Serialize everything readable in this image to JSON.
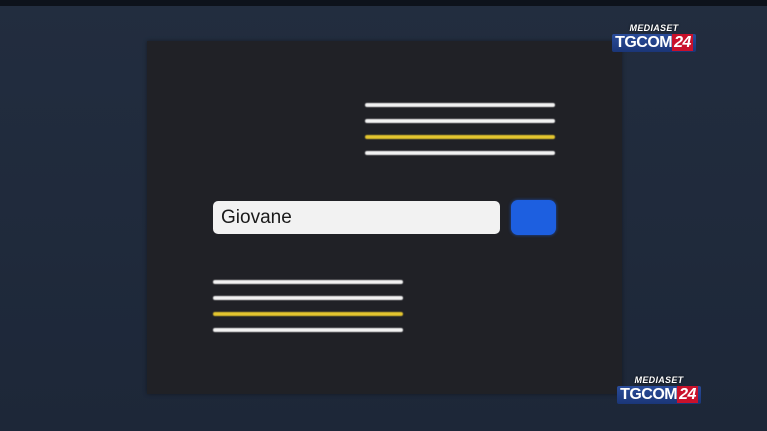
{
  "search": {
    "value": "Giovane"
  },
  "logos": {
    "top": {
      "brand": "MEDIASET",
      "channel_tg": "TGCOM",
      "channel_num": "24"
    },
    "bottom": {
      "brand": "MEDIASET",
      "channel_tg": "TGCOM",
      "channel_num": "24"
    }
  },
  "colors": {
    "background": "#1f2a3b",
    "screen": "#202126",
    "line_white": "#f2f2f2",
    "line_yellow": "#e3c52f",
    "button_blue": "#1d5fe0",
    "brand_red": "#c9112b",
    "brand_blue": "#2a4c9a"
  },
  "icons": {
    "search_button": "blank-blue-button"
  }
}
